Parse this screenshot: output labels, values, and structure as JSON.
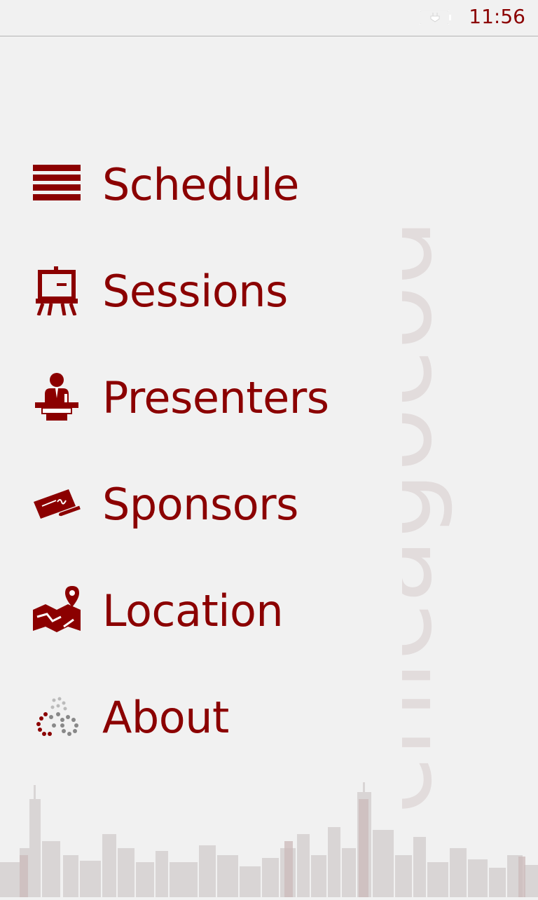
{
  "status_bar": {
    "time": "11:56",
    "battery_icon": "battery-charging-icon"
  },
  "menu": {
    "items": [
      {
        "label": "Schedule",
        "icon": "list-icon"
      },
      {
        "label": "Sessions",
        "icon": "easel-icon"
      },
      {
        "label": "Presenters",
        "icon": "presenter-icon"
      },
      {
        "label": "Sponsors",
        "icon": "check-signing-icon"
      },
      {
        "label": "Location",
        "icon": "map-pin-icon"
      },
      {
        "label": "About",
        "icon": "app-logo-dots-icon"
      }
    ]
  },
  "watermark": {
    "text": "chicagocodecamp"
  },
  "colors": {
    "accent": "#8b0000",
    "background": "#f1f1f1",
    "watermark": "#e0d6d6",
    "skyline": "#cccccc"
  }
}
